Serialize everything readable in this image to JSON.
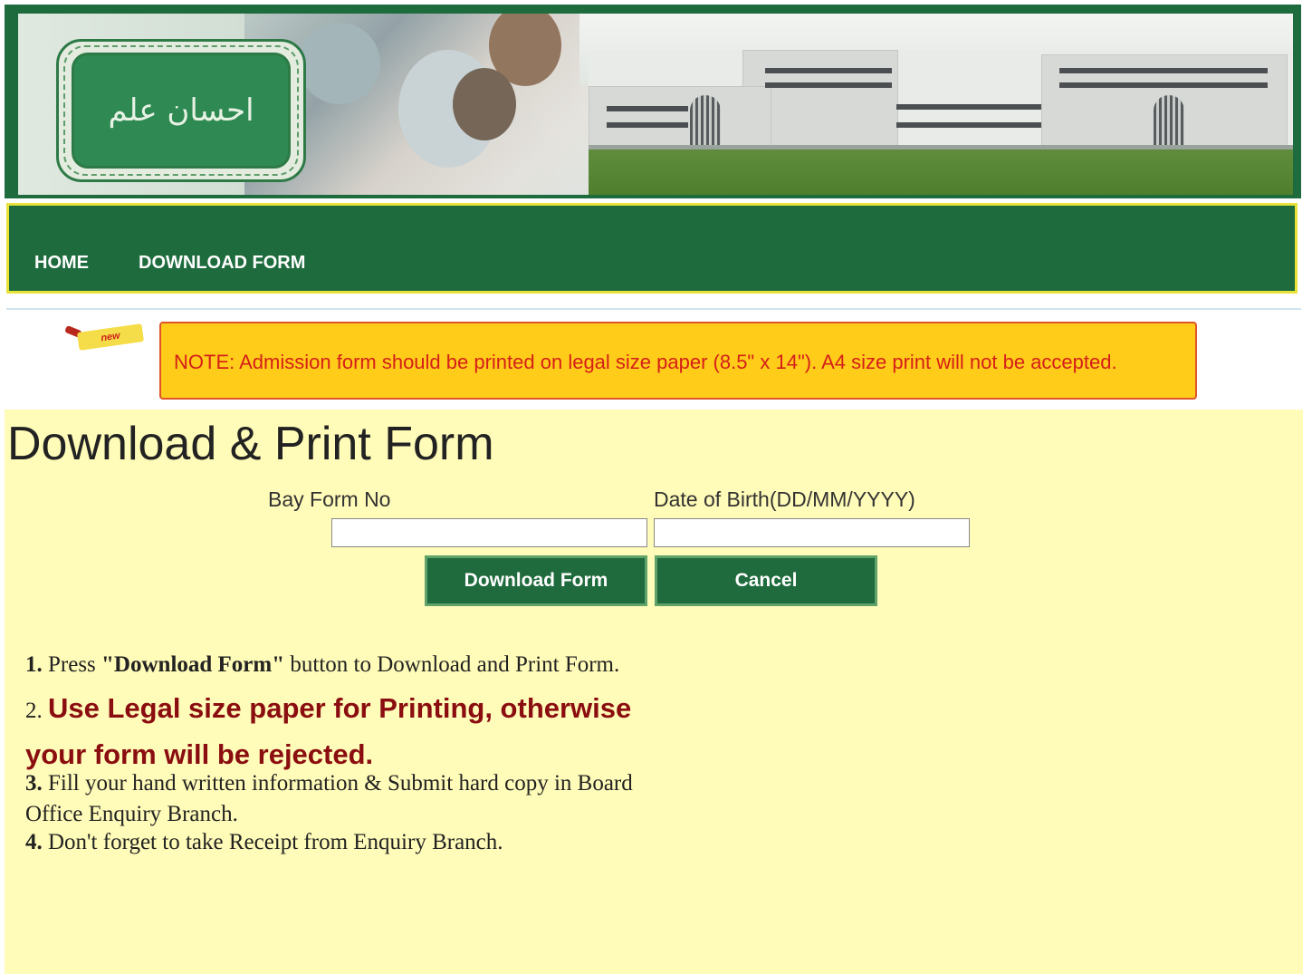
{
  "header": {
    "emblem_text": "احسان علم"
  },
  "nav": {
    "home": "HOME",
    "download_form": "DOWNLOAD FORM"
  },
  "notice": {
    "badge": "new",
    "text": "NOTE: Admission form should be printed on legal size paper (8.5\" x 14\"). A4 size print will not be accepted."
  },
  "main": {
    "title": "Download & Print Form",
    "bay_form_label": "Bay Form No",
    "dob_label": "Date of Birth(DD/MM/YYYY)",
    "bay_form_value": "",
    "dob_value": "",
    "download_button": "Download Form",
    "cancel_button": "Cancel"
  },
  "instructions": {
    "i1_num": "1.",
    "i1_pre": " Press ",
    "i1_bold": "\"Download Form\"",
    "i1_post": " button to Download and Print Form.",
    "i2_num": "2.",
    "i2_text": "Use Legal size paper for Printing, otherwise your form will be rejected.",
    "i3_num": "3.",
    "i3_text": " Fill your hand written information & Submit hard copy in Board Office Enquiry Branch.",
    "i4_num": "4.",
    "i4_text": " Don't forget to take Receipt from Enquiry Branch."
  },
  "colors": {
    "nav_green": "#1e6b3e",
    "nav_border": "#e8e23a",
    "notice_bg": "#ffcc19",
    "notice_text": "#d51f1a",
    "main_bg": "#fffbb8",
    "warning_text": "#8a0d10"
  }
}
